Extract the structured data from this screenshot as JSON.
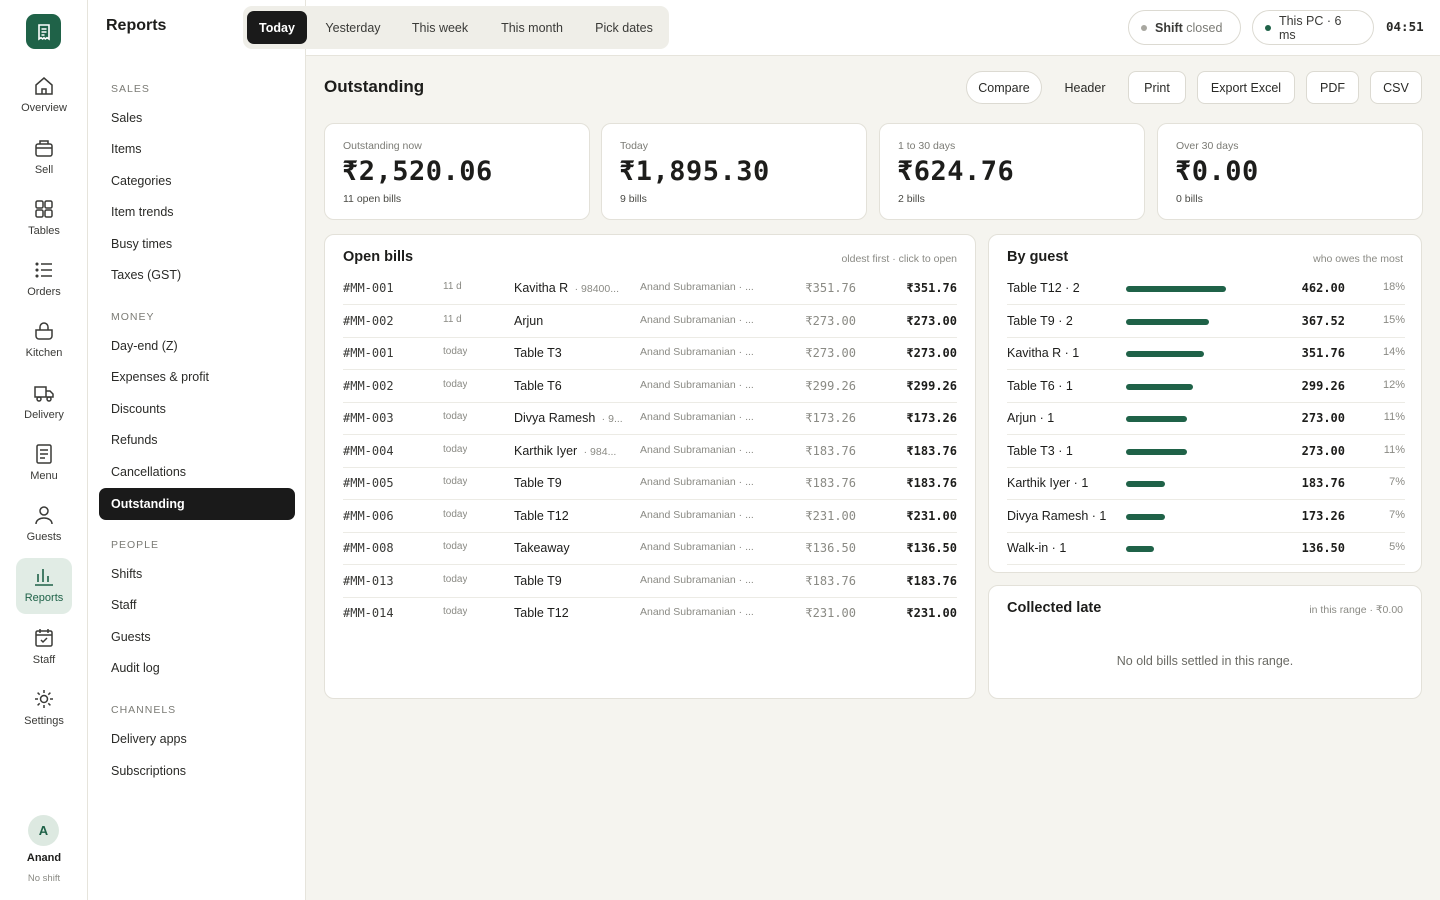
{
  "rail": {
    "items": [
      {
        "label": "Overview",
        "icon": "home-icon"
      },
      {
        "label": "Sell",
        "icon": "register-icon"
      },
      {
        "label": "Tables",
        "icon": "grid-icon"
      },
      {
        "label": "Orders",
        "icon": "list-icon"
      },
      {
        "label": "Kitchen",
        "icon": "pot-icon"
      },
      {
        "label": "Delivery",
        "icon": "truck-icon"
      },
      {
        "label": "Menu",
        "icon": "menu-icon"
      },
      {
        "label": "Guests",
        "icon": "user-icon"
      },
      {
        "label": "Reports",
        "icon": "bar-chart-icon"
      },
      {
        "label": "Staff",
        "icon": "calendar-check-icon"
      },
      {
        "label": "Settings",
        "icon": "sun-gear-icon"
      }
    ],
    "active": "Reports",
    "user": {
      "initial": "A",
      "name": "Anand",
      "shift": "No shift"
    }
  },
  "sidebar": {
    "title": "Reports",
    "sections": [
      {
        "label": "SALES",
        "items": [
          "Sales",
          "Items",
          "Categories",
          "Item trends",
          "Busy times",
          "Taxes (GST)"
        ]
      },
      {
        "label": "MONEY",
        "items": [
          "Day-end (Z)",
          "Expenses & profit",
          "Discounts",
          "Refunds",
          "Cancellations",
          "Outstanding"
        ]
      },
      {
        "label": "PEOPLE",
        "items": [
          "Shifts",
          "Staff",
          "Guests",
          "Audit log"
        ]
      },
      {
        "label": "CHANNELS",
        "items": [
          "Delivery apps",
          "Subscriptions"
        ]
      }
    ],
    "active": "Outstanding"
  },
  "topbar": {
    "ranges": [
      "Today",
      "Yesterday",
      "This week",
      "This month",
      "Pick dates"
    ],
    "active_range": "Today",
    "shift_label": "Shift",
    "shift_status": "closed",
    "device": "This PC · 6 ms",
    "clock": "04:51"
  },
  "page": {
    "title": "Outstanding",
    "actions": [
      "Compare",
      "Header",
      "Print",
      "Export Excel",
      "PDF",
      "CSV"
    ]
  },
  "stats": [
    {
      "label": "Outstanding now",
      "value": "₹2,520.06",
      "sub": "11 open bills"
    },
    {
      "label": "Today",
      "value": "₹1,895.30",
      "sub": "9 bills"
    },
    {
      "label": "1 to 30 days",
      "value": "₹624.76",
      "sub": "2 bills"
    },
    {
      "label": "Over 30 days",
      "value": "₹0.00",
      "sub": "0 bills"
    }
  ],
  "open_bills": {
    "title": "Open bills",
    "note": "oldest first · click to open",
    "rows": [
      {
        "id": "#MM-001",
        "age": "11 d",
        "guest": "Kavitha R",
        "phone": "98400...",
        "staff": "Anand Subramanian · ...",
        "amount": "₹351.76",
        "due": "₹351.76"
      },
      {
        "id": "#MM-002",
        "age": "11 d",
        "guest": "Arjun",
        "phone": "",
        "staff": "Anand Subramanian · ...",
        "amount": "₹273.00",
        "due": "₹273.00"
      },
      {
        "id": "#MM-001",
        "age": "today",
        "guest": "Table T3",
        "phone": "",
        "staff": "Anand Subramanian · ...",
        "amount": "₹273.00",
        "due": "₹273.00"
      },
      {
        "id": "#MM-002",
        "age": "today",
        "guest": "Table T6",
        "phone": "",
        "staff": "Anand Subramanian · ...",
        "amount": "₹299.26",
        "due": "₹299.26"
      },
      {
        "id": "#MM-003",
        "age": "today",
        "guest": "Divya Ramesh",
        "phone": "9...",
        "staff": "Anand Subramanian · ...",
        "amount": "₹173.26",
        "due": "₹173.26"
      },
      {
        "id": "#MM-004",
        "age": "today",
        "guest": "Karthik Iyer",
        "phone": "984...",
        "staff": "Anand Subramanian · ...",
        "amount": "₹183.76",
        "due": "₹183.76"
      },
      {
        "id": "#MM-005",
        "age": "today",
        "guest": "Table T9",
        "phone": "",
        "staff": "Anand Subramanian · ...",
        "amount": "₹183.76",
        "due": "₹183.76"
      },
      {
        "id": "#MM-006",
        "age": "today",
        "guest": "Table T12",
        "phone": "",
        "staff": "Anand Subramanian · ...",
        "amount": "₹231.00",
        "due": "₹231.00"
      },
      {
        "id": "#MM-008",
        "age": "today",
        "guest": "Takeaway",
        "phone": "",
        "staff": "Anand Subramanian · ...",
        "amount": "₹136.50",
        "due": "₹136.50"
      },
      {
        "id": "#MM-013",
        "age": "today",
        "guest": "Table T9",
        "phone": "",
        "staff": "Anand Subramanian · ...",
        "amount": "₹183.76",
        "due": "₹183.76"
      },
      {
        "id": "#MM-014",
        "age": "today",
        "guest": "Table T12",
        "phone": "",
        "staff": "Anand Subramanian · ...",
        "amount": "₹231.00",
        "due": "₹231.00"
      }
    ]
  },
  "by_guest": {
    "title": "By guest",
    "note": "who owes the most",
    "bar_color": "#1f6248",
    "rows": [
      {
        "name": "Table T12 · 2",
        "amount": "462.00",
        "share": 0.18,
        "pct": "18%"
      },
      {
        "name": "Table T9 · 2",
        "amount": "367.52",
        "share": 0.15,
        "pct": "15%"
      },
      {
        "name": "Kavitha R · 1",
        "amount": "351.76",
        "share": 0.14,
        "pct": "14%"
      },
      {
        "name": "Table T6 · 1",
        "amount": "299.26",
        "share": 0.12,
        "pct": "12%"
      },
      {
        "name": "Arjun · 1",
        "amount": "273.00",
        "share": 0.11,
        "pct": "11%"
      },
      {
        "name": "Table T3 · 1",
        "amount": "273.00",
        "share": 0.11,
        "pct": "11%"
      },
      {
        "name": "Karthik Iyer · 1",
        "amount": "183.76",
        "share": 0.07,
        "pct": "7%"
      },
      {
        "name": "Divya Ramesh · 1",
        "amount": "173.26",
        "share": 0.07,
        "pct": "7%"
      },
      {
        "name": "Walk-in · 1",
        "amount": "136.50",
        "share": 0.05,
        "pct": "5%"
      }
    ]
  },
  "collected_late": {
    "title": "Collected late",
    "note": "in this range · ₹0.00",
    "empty": "No old bills settled in this range."
  }
}
